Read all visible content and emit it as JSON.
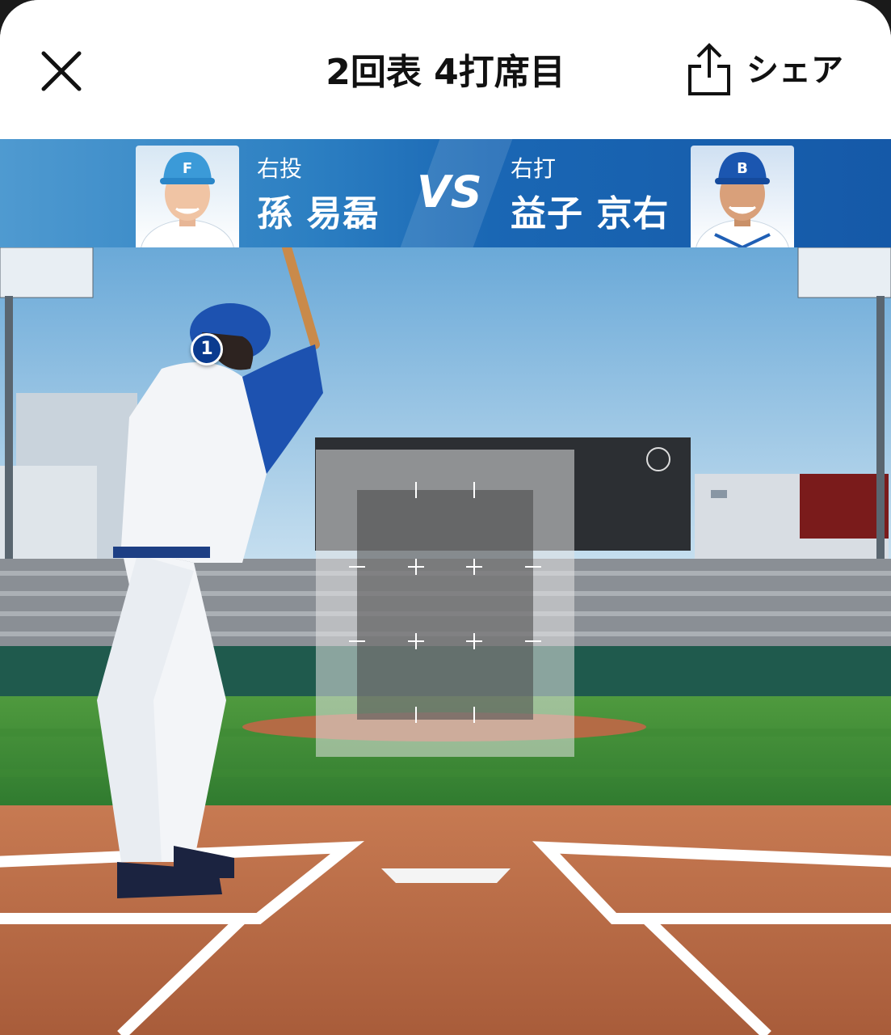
{
  "header": {
    "title": "2回表 4打席目",
    "share_label": "シェア"
  },
  "matchup": {
    "pitcher": {
      "hand": "右投",
      "name": "孫 易磊",
      "cap_letter": "F"
    },
    "vs_label": "VS",
    "batter": {
      "hand": "右打",
      "name": "益子 京右",
      "cap_letter": "B"
    }
  },
  "pitch_marker": {
    "number": "1"
  },
  "colors": {
    "banner_blue": "#1a67b4",
    "marker_navy": "#0a3b8f",
    "grass": "#3f8f3a",
    "dirt": "#b86a44"
  },
  "icons": [
    "close-icon",
    "share-icon"
  ]
}
